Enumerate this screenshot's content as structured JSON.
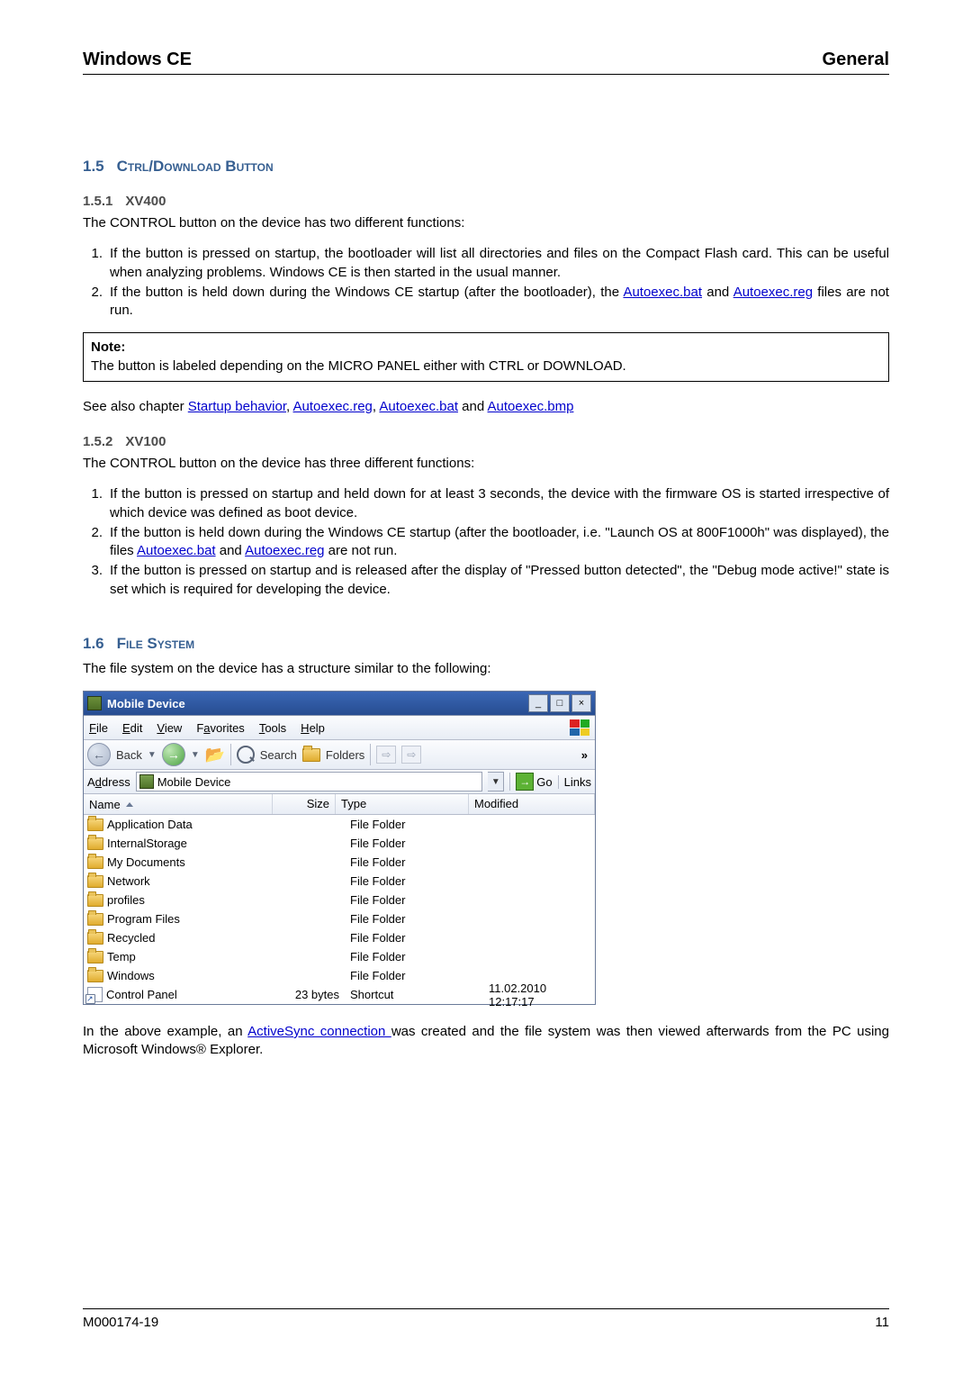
{
  "header": {
    "left": "Windows CE",
    "right": "General"
  },
  "footer": {
    "left": "M000174-19",
    "right": "11"
  },
  "sec15": {
    "num": "1.5",
    "title": "Ctrl/Download Button",
    "sub1": {
      "num": "1.5.1",
      "title": "XV400",
      "intro": "The CONTROL button on the device has two different functions:",
      "items": [
        {
          "num": "1.",
          "text_a": "If the button is pressed on startup, the bootloader will list all directories and files on the Compact Flash card. This can be useful when analyzing problems. Windows CE is then started in the usual manner."
        },
        {
          "num": "2.",
          "text_a": "If the button is held down during the Windows CE startup (after the bootloader), the ",
          "link1": "Autoexec.bat",
          "text_b": " and ",
          "link2": "Autoexec.reg",
          "text_c": " files are not run."
        }
      ],
      "note_head": "Note:",
      "note_body": "The button is labeled depending on the MICRO PANEL either with CTRL or DOWNLOAD.",
      "seealso_pre": "See also chapter ",
      "sa1": "Startup behavior",
      "sa2": "Autoexec.reg",
      "sa3": "Autoexec.bat",
      "sa4": "Autoexec.bmp"
    },
    "sub2": {
      "num": "1.5.2",
      "title": "XV100",
      "intro": "The CONTROL button on the device has three different functions:",
      "items": [
        {
          "num": "1.",
          "text_a": "If the button is pressed on startup and held down for at least 3 seconds, the device with the firmware OS is started irrespective of which device was defined as boot device."
        },
        {
          "num": "2.",
          "text_a": "If the button is held down during the Windows CE startup (after the bootloader, i.e. \"Launch OS at 800F1000h\" was displayed), the files ",
          "link1": "Autoexec.bat",
          "text_b": " and ",
          "link2": "Autoexec.reg",
          "text_c": " are not run."
        },
        {
          "num": "3.",
          "text_a": "If the button is pressed on startup and is released after the display of \"Pressed button detected\", the \"Debug mode active!\" state is set which is required for developing the device."
        }
      ]
    }
  },
  "sec16": {
    "num": "1.6",
    "title": "File System",
    "intro": "The file system on the device has a structure similar to the following:",
    "outro_a": "In the above example, an ",
    "outro_link": "ActiveSync connection ",
    "outro_b": " was created and the file system was then viewed afterwards from the PC using Microsoft Windows® Explorer."
  },
  "explorer": {
    "title": "Mobile Device",
    "menus": {
      "file": "File",
      "edit": "Edit",
      "view": "View",
      "fav": "Favorites",
      "tools": "Tools",
      "help": "Help"
    },
    "toolbar": {
      "back": "Back",
      "search": "Search",
      "folders": "Folders"
    },
    "address": {
      "label": "Address",
      "value": "Mobile Device",
      "go": "Go",
      "links": "Links"
    },
    "cols": {
      "name": "Name",
      "size": "Size",
      "type": "Type",
      "mod": "Modified"
    },
    "rows": [
      {
        "name": "Application Data",
        "size": "",
        "type": "File Folder",
        "mod": ""
      },
      {
        "name": "InternalStorage",
        "size": "",
        "type": "File Folder",
        "mod": ""
      },
      {
        "name": "My Documents",
        "size": "",
        "type": "File Folder",
        "mod": ""
      },
      {
        "name": "Network",
        "size": "",
        "type": "File Folder",
        "mod": ""
      },
      {
        "name": "profiles",
        "size": "",
        "type": "File Folder",
        "mod": ""
      },
      {
        "name": "Program Files",
        "size": "",
        "type": "File Folder",
        "mod": ""
      },
      {
        "name": "Recycled",
        "size": "",
        "type": "File Folder",
        "mod": ""
      },
      {
        "name": "Temp",
        "size": "",
        "type": "File Folder",
        "mod": ""
      },
      {
        "name": "Windows",
        "size": "",
        "type": "File Folder",
        "mod": ""
      },
      {
        "name": "Control Panel",
        "size": "23 bytes",
        "type": "Shortcut",
        "mod": "11.02.2010  12:17:17",
        "shortcut": true
      }
    ]
  }
}
